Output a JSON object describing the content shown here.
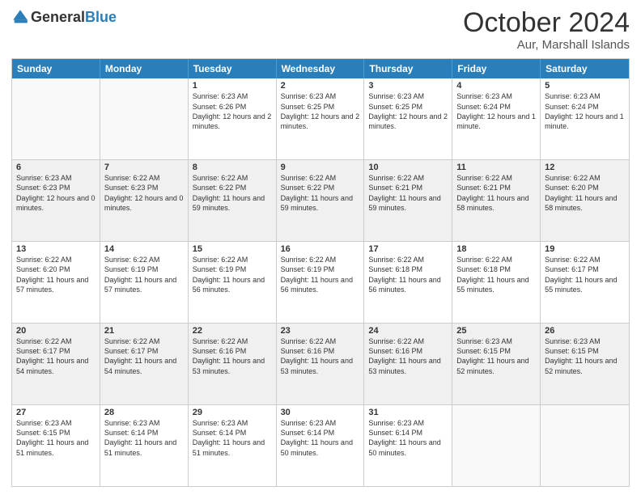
{
  "header": {
    "logo_general": "General",
    "logo_blue": "Blue",
    "month_title": "October 2024",
    "location": "Aur, Marshall Islands"
  },
  "days_of_week": [
    "Sunday",
    "Monday",
    "Tuesday",
    "Wednesday",
    "Thursday",
    "Friday",
    "Saturday"
  ],
  "weeks": [
    [
      {
        "day": "",
        "empty": true
      },
      {
        "day": "",
        "empty": true
      },
      {
        "day": "1",
        "sunrise": "Sunrise: 6:23 AM",
        "sunset": "Sunset: 6:26 PM",
        "daylight": "Daylight: 12 hours and 2 minutes."
      },
      {
        "day": "2",
        "sunrise": "Sunrise: 6:23 AM",
        "sunset": "Sunset: 6:25 PM",
        "daylight": "Daylight: 12 hours and 2 minutes."
      },
      {
        "day": "3",
        "sunrise": "Sunrise: 6:23 AM",
        "sunset": "Sunset: 6:25 PM",
        "daylight": "Daylight: 12 hours and 2 minutes."
      },
      {
        "day": "4",
        "sunrise": "Sunrise: 6:23 AM",
        "sunset": "Sunset: 6:24 PM",
        "daylight": "Daylight: 12 hours and 1 minute."
      },
      {
        "day": "5",
        "sunrise": "Sunrise: 6:23 AM",
        "sunset": "Sunset: 6:24 PM",
        "daylight": "Daylight: 12 hours and 1 minute."
      }
    ],
    [
      {
        "day": "6",
        "sunrise": "Sunrise: 6:23 AM",
        "sunset": "Sunset: 6:23 PM",
        "daylight": "Daylight: 12 hours and 0 minutes."
      },
      {
        "day": "7",
        "sunrise": "Sunrise: 6:22 AM",
        "sunset": "Sunset: 6:23 PM",
        "daylight": "Daylight: 12 hours and 0 minutes."
      },
      {
        "day": "8",
        "sunrise": "Sunrise: 6:22 AM",
        "sunset": "Sunset: 6:22 PM",
        "daylight": "Daylight: 11 hours and 59 minutes."
      },
      {
        "day": "9",
        "sunrise": "Sunrise: 6:22 AM",
        "sunset": "Sunset: 6:22 PM",
        "daylight": "Daylight: 11 hours and 59 minutes."
      },
      {
        "day": "10",
        "sunrise": "Sunrise: 6:22 AM",
        "sunset": "Sunset: 6:21 PM",
        "daylight": "Daylight: 11 hours and 59 minutes."
      },
      {
        "day": "11",
        "sunrise": "Sunrise: 6:22 AM",
        "sunset": "Sunset: 6:21 PM",
        "daylight": "Daylight: 11 hours and 58 minutes."
      },
      {
        "day": "12",
        "sunrise": "Sunrise: 6:22 AM",
        "sunset": "Sunset: 6:20 PM",
        "daylight": "Daylight: 11 hours and 58 minutes."
      }
    ],
    [
      {
        "day": "13",
        "sunrise": "Sunrise: 6:22 AM",
        "sunset": "Sunset: 6:20 PM",
        "daylight": "Daylight: 11 hours and 57 minutes."
      },
      {
        "day": "14",
        "sunrise": "Sunrise: 6:22 AM",
        "sunset": "Sunset: 6:19 PM",
        "daylight": "Daylight: 11 hours and 57 minutes."
      },
      {
        "day": "15",
        "sunrise": "Sunrise: 6:22 AM",
        "sunset": "Sunset: 6:19 PM",
        "daylight": "Daylight: 11 hours and 56 minutes."
      },
      {
        "day": "16",
        "sunrise": "Sunrise: 6:22 AM",
        "sunset": "Sunset: 6:19 PM",
        "daylight": "Daylight: 11 hours and 56 minutes."
      },
      {
        "day": "17",
        "sunrise": "Sunrise: 6:22 AM",
        "sunset": "Sunset: 6:18 PM",
        "daylight": "Daylight: 11 hours and 56 minutes."
      },
      {
        "day": "18",
        "sunrise": "Sunrise: 6:22 AM",
        "sunset": "Sunset: 6:18 PM",
        "daylight": "Daylight: 11 hours and 55 minutes."
      },
      {
        "day": "19",
        "sunrise": "Sunrise: 6:22 AM",
        "sunset": "Sunset: 6:17 PM",
        "daylight": "Daylight: 11 hours and 55 minutes."
      }
    ],
    [
      {
        "day": "20",
        "sunrise": "Sunrise: 6:22 AM",
        "sunset": "Sunset: 6:17 PM",
        "daylight": "Daylight: 11 hours and 54 minutes."
      },
      {
        "day": "21",
        "sunrise": "Sunrise: 6:22 AM",
        "sunset": "Sunset: 6:17 PM",
        "daylight": "Daylight: 11 hours and 54 minutes."
      },
      {
        "day": "22",
        "sunrise": "Sunrise: 6:22 AM",
        "sunset": "Sunset: 6:16 PM",
        "daylight": "Daylight: 11 hours and 53 minutes."
      },
      {
        "day": "23",
        "sunrise": "Sunrise: 6:22 AM",
        "sunset": "Sunset: 6:16 PM",
        "daylight": "Daylight: 11 hours and 53 minutes."
      },
      {
        "day": "24",
        "sunrise": "Sunrise: 6:22 AM",
        "sunset": "Sunset: 6:16 PM",
        "daylight": "Daylight: 11 hours and 53 minutes."
      },
      {
        "day": "25",
        "sunrise": "Sunrise: 6:23 AM",
        "sunset": "Sunset: 6:15 PM",
        "daylight": "Daylight: 11 hours and 52 minutes."
      },
      {
        "day": "26",
        "sunrise": "Sunrise: 6:23 AM",
        "sunset": "Sunset: 6:15 PM",
        "daylight": "Daylight: 11 hours and 52 minutes."
      }
    ],
    [
      {
        "day": "27",
        "sunrise": "Sunrise: 6:23 AM",
        "sunset": "Sunset: 6:15 PM",
        "daylight": "Daylight: 11 hours and 51 minutes."
      },
      {
        "day": "28",
        "sunrise": "Sunrise: 6:23 AM",
        "sunset": "Sunset: 6:14 PM",
        "daylight": "Daylight: 11 hours and 51 minutes."
      },
      {
        "day": "29",
        "sunrise": "Sunrise: 6:23 AM",
        "sunset": "Sunset: 6:14 PM",
        "daylight": "Daylight: 11 hours and 51 minutes."
      },
      {
        "day": "30",
        "sunrise": "Sunrise: 6:23 AM",
        "sunset": "Sunset: 6:14 PM",
        "daylight": "Daylight: 11 hours and 50 minutes."
      },
      {
        "day": "31",
        "sunrise": "Sunrise: 6:23 AM",
        "sunset": "Sunset: 6:14 PM",
        "daylight": "Daylight: 11 hours and 50 minutes."
      },
      {
        "day": "",
        "empty": true
      },
      {
        "day": "",
        "empty": true
      }
    ]
  ]
}
